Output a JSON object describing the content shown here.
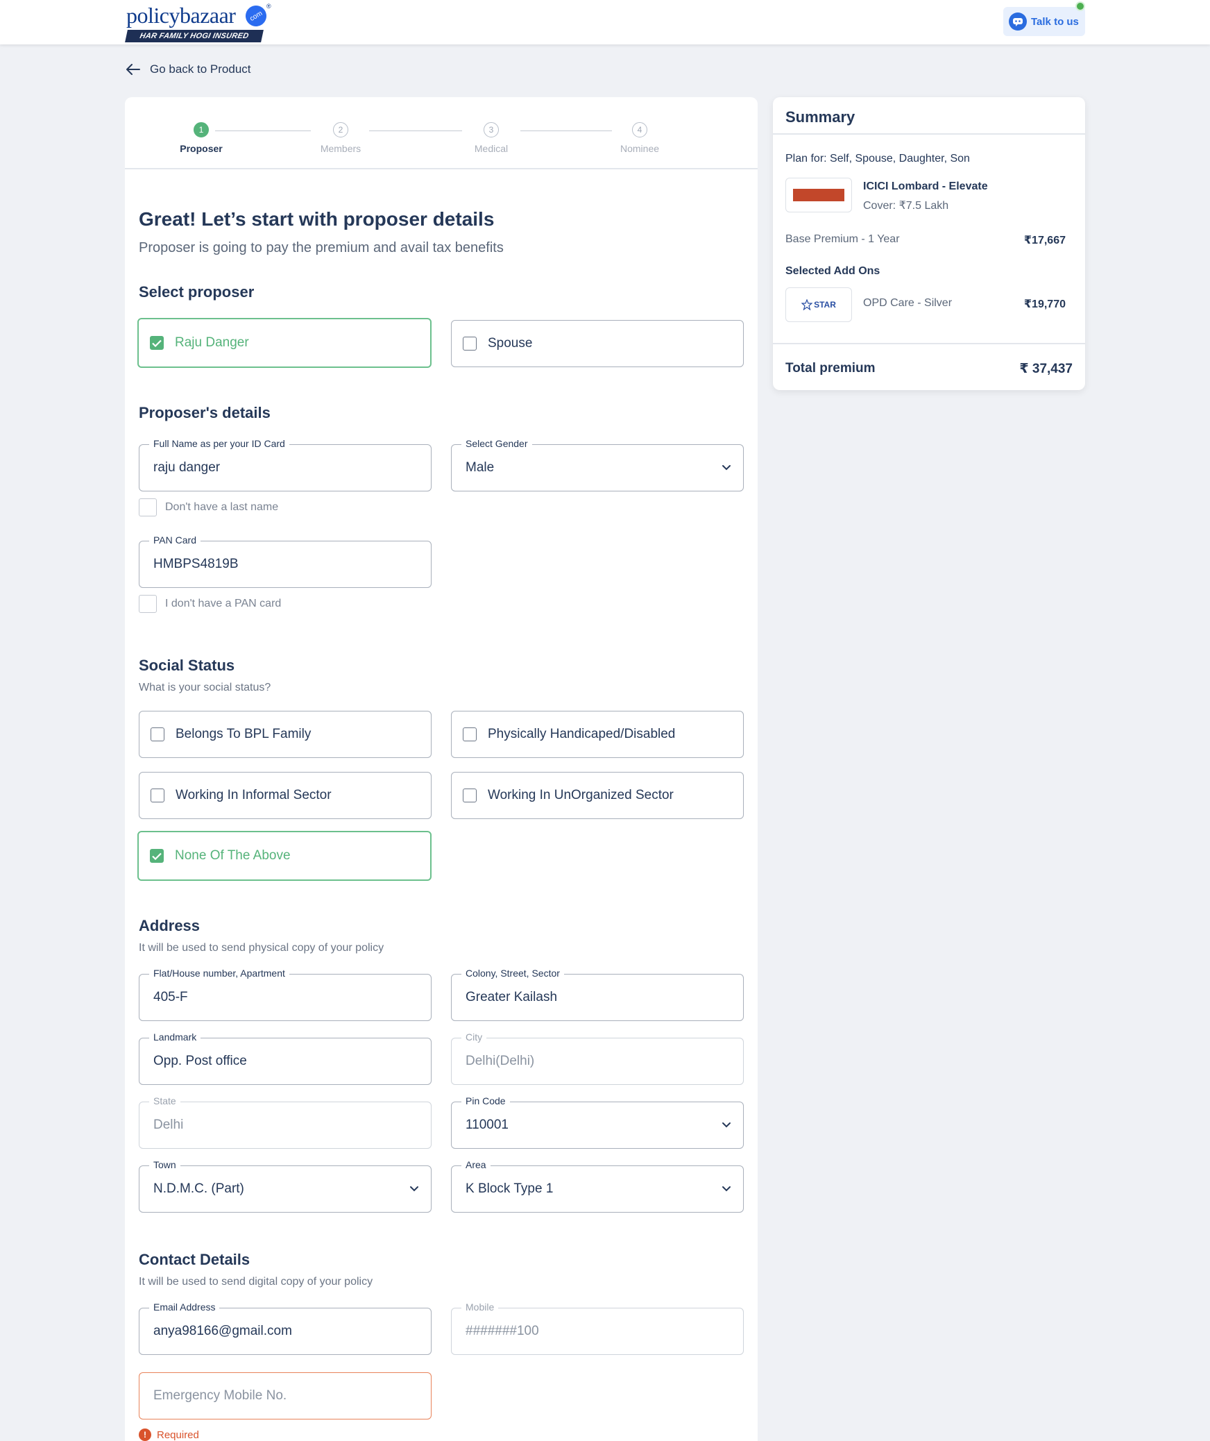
{
  "header": {
    "logo_text": "policy",
    "logo_text_b": "bazaar",
    "logo_com": "com",
    "logo_tagline": "HAR FAMILY HOGI INSURED",
    "talk_label": "Talk to us"
  },
  "back_label": "Go back to Product",
  "stepper": {
    "steps": [
      {
        "number": "1",
        "label": "Proposer"
      },
      {
        "number": "2",
        "label": "Members"
      },
      {
        "number": "3",
        "label": "Medical"
      },
      {
        "number": "4",
        "label": "Nominee"
      }
    ]
  },
  "form": {
    "title": "Great! Let’s start with proposer details",
    "subtitle": "Proposer is going to pay the premium and avail tax benefits",
    "select_proposer": {
      "title": "Select proposer",
      "options": [
        {
          "label": "Raju Danger",
          "checked": true
        },
        {
          "label": "Spouse",
          "checked": false
        }
      ]
    },
    "proposer_details": {
      "title": "Proposer's details",
      "full_name": {
        "label": "Full Name as per your ID Card",
        "value": "raju danger"
      },
      "gender": {
        "label": "Select Gender",
        "value": "Male"
      },
      "no_last_name": "Don't have a last name",
      "pan": {
        "label": "PAN Card",
        "value": "HMBPS4819B"
      },
      "no_pan": "I don't have a PAN card"
    },
    "social_status": {
      "title": "Social Status",
      "subtitle": "What is your social status?",
      "options": [
        {
          "label": "Belongs To BPL Family",
          "checked": false
        },
        {
          "label": "Physically Handicaped/Disabled",
          "checked": false
        },
        {
          "label": "Working In Informal Sector",
          "checked": false
        },
        {
          "label": "Working In UnOrganized Sector",
          "checked": false
        },
        {
          "label": "None Of The Above",
          "checked": true
        }
      ]
    },
    "address": {
      "title": "Address",
      "subtitle": "It will be used to send physical copy of your policy",
      "flat": {
        "label": "Flat/House number, Apartment",
        "value": "405-F"
      },
      "colony": {
        "label": "Colony, Street, Sector",
        "value": "Greater Kailash"
      },
      "landmark": {
        "label": "Landmark",
        "value": "Opp. Post office"
      },
      "city": {
        "label": "City",
        "value": "Delhi(Delhi)"
      },
      "state": {
        "label": "State",
        "value": "Delhi"
      },
      "pincode": {
        "label": "Pin Code",
        "value": "110001"
      },
      "town": {
        "label": "Town",
        "value": "N.D.M.C. (Part)"
      },
      "area": {
        "label": "Area",
        "value": "K Block Type 1"
      }
    },
    "contact": {
      "title": "Contact Details",
      "subtitle": "It will be used to send digital copy of your policy",
      "email": {
        "label": "Email Address",
        "value": "anya98166@gmail.com"
      },
      "mobile": {
        "label": "Mobile",
        "value": "#######100"
      },
      "emergency_placeholder": "Emergency Mobile No.",
      "required_msg": "Required"
    }
  },
  "summary": {
    "title": "Summary",
    "plan_for": "Plan for: Self, Spouse, Daughter, Son",
    "plan_name": "ICICI Lombard - Elevate",
    "cover": "Cover: ₹7.5 Lakh",
    "base_premium_label": "Base Premium - 1 Year",
    "base_premium_value": "₹17,667",
    "addons_title": "Selected Add Ons",
    "addon_logo_text": "STAR",
    "addon_name": "OPD Care - Silver",
    "addon_value": "₹19,770",
    "total_label": "Total premium",
    "total_value": "₹ 37,437"
  },
  "colors": {
    "primary": "#253858",
    "success": "#55b37a",
    "accent": "#2a6cdf",
    "error": "#d9532c"
  }
}
